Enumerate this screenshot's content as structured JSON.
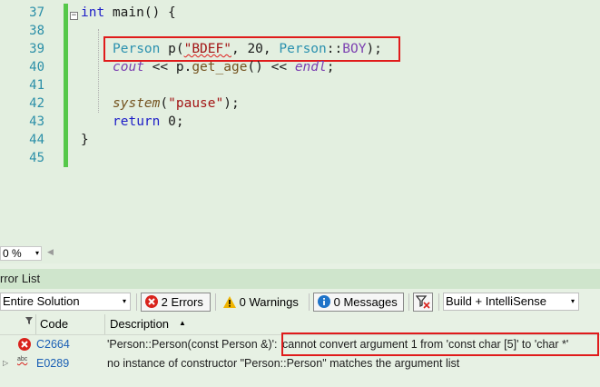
{
  "editor": {
    "line_numbers": [
      "37",
      "38",
      "39",
      "40",
      "41",
      "42",
      "43",
      "44",
      "45"
    ],
    "collapse_glyph": "−",
    "code": {
      "l37_kw": "int",
      "l37_rest": " main() {",
      "l39_type": "Person",
      "l39_var": " p(",
      "l39_str": "\"BDEF\"",
      "l39_mid": ", 20, ",
      "l39_type2": "Person",
      "l39_scope": "::",
      "l39_enum": "BOY",
      "l39_end": ");",
      "l40_cout": "cout",
      "l40_op": " << p.",
      "l40_fn": "get_age",
      "l40_op2": "() << ",
      "l40_endl": "endl",
      "l40_end": ";",
      "l42_fn": "system",
      "l42_open": "(",
      "l42_str": "\"pause\"",
      "l42_end": ");",
      "l43_kw": "return",
      "l43_rest": " 0;",
      "l44": "}"
    }
  },
  "zoom": {
    "value": "0 %",
    "arrow": "▾"
  },
  "hscroll_arrow": "◀",
  "panel": {
    "title": "rror List"
  },
  "toolbar": {
    "scope": "Entire Solution",
    "scope_arrow": "▾",
    "errors": "2 Errors",
    "warnings": "0 Warnings",
    "messages": "0 Messages",
    "build": "Build + IntelliSense",
    "build_arrow": "▾"
  },
  "grid": {
    "headers": {
      "code": "Code",
      "description": "Description",
      "sort": "▲"
    },
    "rows": [
      {
        "code": "C2664",
        "desc_a": "'Person::Person(const Person &)':",
        "desc_b": " cannot convert argument 1 from 'const char [5]' to 'char *'",
        "icon": "error-icon"
      },
      {
        "code": "E0289",
        "desc_a": "no instance of constructor \"Person::Person\" matches the argument list",
        "desc_b": "",
        "icon": "intellisense-error-icon",
        "expander": "▷",
        "abc": "abc"
      }
    ]
  },
  "colors": {
    "error_red": "#e01b1b",
    "link_blue": "#1a5fb4",
    "editor_bg": "#e3efe0"
  }
}
